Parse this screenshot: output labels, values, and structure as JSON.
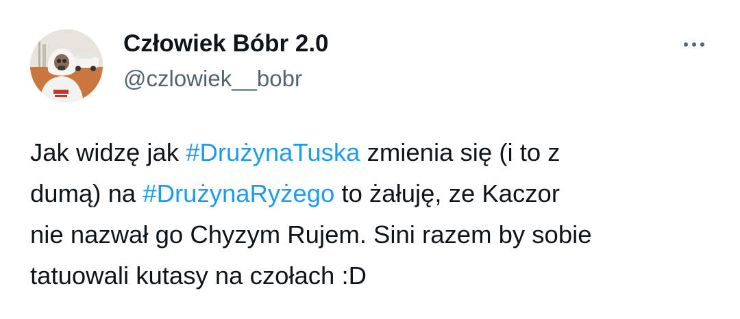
{
  "user": {
    "display_name": "Człowiek Bóbr 2.0",
    "handle": "@czlowiek__bobr"
  },
  "icons": {
    "more": "more-horizontal-icon"
  },
  "tweet": {
    "line1": {
      "before": "Jak widzę jak ",
      "hashtag": "#DrużynaTuska",
      "after": " zmienia się (i to z"
    },
    "line2": {
      "before": "dumą) na ",
      "hashtag": "#DrużynaRyżego",
      "after": " to żałuję, ze Kaczor"
    },
    "line3": "nie nazwał go Chyzym Rujem. Sini razem by sobie",
    "line4": "tatuowali kutasy na czołach :D"
  },
  "colors": {
    "text": "#0f1419",
    "secondary": "#536471",
    "link": "#1d9bf0",
    "background": "#ffffff"
  }
}
